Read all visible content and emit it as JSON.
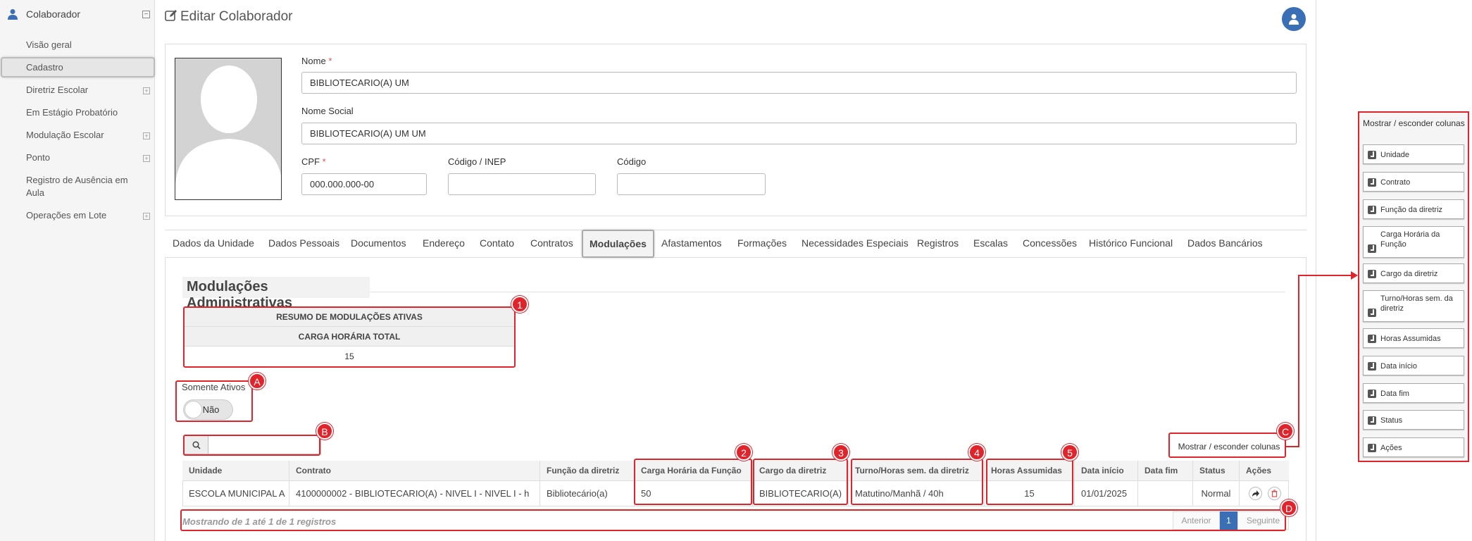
{
  "sidebar": {
    "title": "Colaborador",
    "items": [
      {
        "label": "Visão geral"
      },
      {
        "label": "Cadastro"
      },
      {
        "label": "Diretriz Escolar"
      },
      {
        "label": "Em Estágio Probatório"
      },
      {
        "label": "Modulação Escolar"
      },
      {
        "label": "Ponto"
      },
      {
        "label": "Registro de Ausência em Aula"
      },
      {
        "label": "Operações em Lote"
      }
    ]
  },
  "page": {
    "title": "Editar Colaborador"
  },
  "form": {
    "nome_label": "Nome",
    "nome_value": "BIBLIOTECARIO(A) UM",
    "nome_social_label": "Nome Social",
    "nome_social_value": "BIBLIOTECARIO(A) UM UM",
    "cpf_label": "CPF",
    "cpf_value": "000.000.000-00",
    "inep_label": "Código / INEP",
    "inep_value": "",
    "codigo_label": "Código",
    "codigo_value": "",
    "required_mark": "*"
  },
  "tabs": [
    "Dados da Unidade",
    "Dados Pessoais",
    "Documentos",
    "Endereço",
    "Contato",
    "Contratos",
    "Modulações",
    "Afastamentos",
    "Formações",
    "Necessidades Especiais",
    "Registros",
    "Escalas",
    "Concessões",
    "Histórico Funcional",
    "Dados Bancários"
  ],
  "section": {
    "title": "Modulações Administrativas",
    "summary": {
      "header1": "RESUMO DE MODULAÇÕES ATIVAS",
      "header2": "CARGA HORÁRIA TOTAL",
      "value": "15"
    },
    "only_active_label": "Somente Ativos",
    "only_active_value": "Não",
    "search_value": "",
    "colvis_label": "Mostrar / esconder colunas"
  },
  "table": {
    "headers": [
      "Unidade",
      "Contrato",
      "Função da diretriz",
      "Carga Horária da Função",
      "Cargo da diretriz",
      "Turno/Horas sem. da diretriz",
      "Horas Assumidas",
      "Data início",
      "Data fim",
      "Status",
      "Ações"
    ],
    "rows": [
      [
        "ESCOLA MUNICIPAL A",
        "4100000002 - BIBLIOTECARIO(A) - NIVEL I - NIVEL I - h",
        "Bibliotecário(a)",
        "50",
        "BIBLIOTECARIO(A)",
        "Matutino/Manhã / 40h",
        "15",
        "01/01/2025",
        "",
        "Normal"
      ]
    ],
    "info": "Mostrando de 1 até 1 de 1 registros",
    "prev": "Anterior",
    "page": "1",
    "next": "Seguinte"
  },
  "annotations": {
    "n1": "1",
    "n2": "2",
    "n3": "3",
    "n4": "4",
    "n5": "5",
    "a": "A",
    "b": "B",
    "c": "C",
    "d": "D",
    "accent": "#e0242c"
  },
  "colvis_panel": {
    "title": "Mostrar / esconder colunas",
    "items": [
      "Unidade",
      "Contrato",
      "Função da diretriz",
      "Carga Horária da Função",
      "Cargo da diretriz",
      "Turno/Horas sem. da diretriz",
      "Horas Assumidas",
      "Data início",
      "Data fim",
      "Status",
      "Ações"
    ]
  },
  "colors": {
    "primary": "#3a6fb5",
    "annotation": "#e0242c"
  }
}
